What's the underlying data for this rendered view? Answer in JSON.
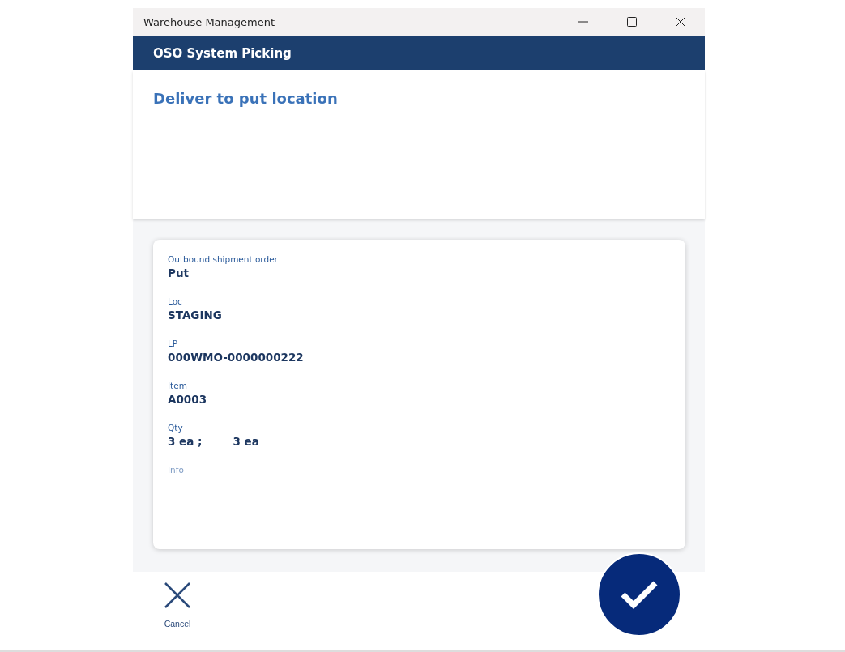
{
  "window": {
    "title": "Warehouse Management"
  },
  "header": {
    "title": "OSO System Picking"
  },
  "page_title": "Deliver to put location",
  "fields": [
    {
      "label": "Outbound shipment order",
      "values": [
        "Put"
      ]
    },
    {
      "label": "Loc",
      "values": [
        "STAGING"
      ]
    },
    {
      "label": "LP",
      "values": [
        "000WMO-0000000222"
      ]
    },
    {
      "label": "Item",
      "values": [
        "A0003"
      ]
    },
    {
      "label": "Qty",
      "values": [
        "3 ea ;",
        "3 ea"
      ]
    },
    {
      "label": "Info"
    }
  ],
  "cancel": {
    "label": "Cancel"
  }
}
